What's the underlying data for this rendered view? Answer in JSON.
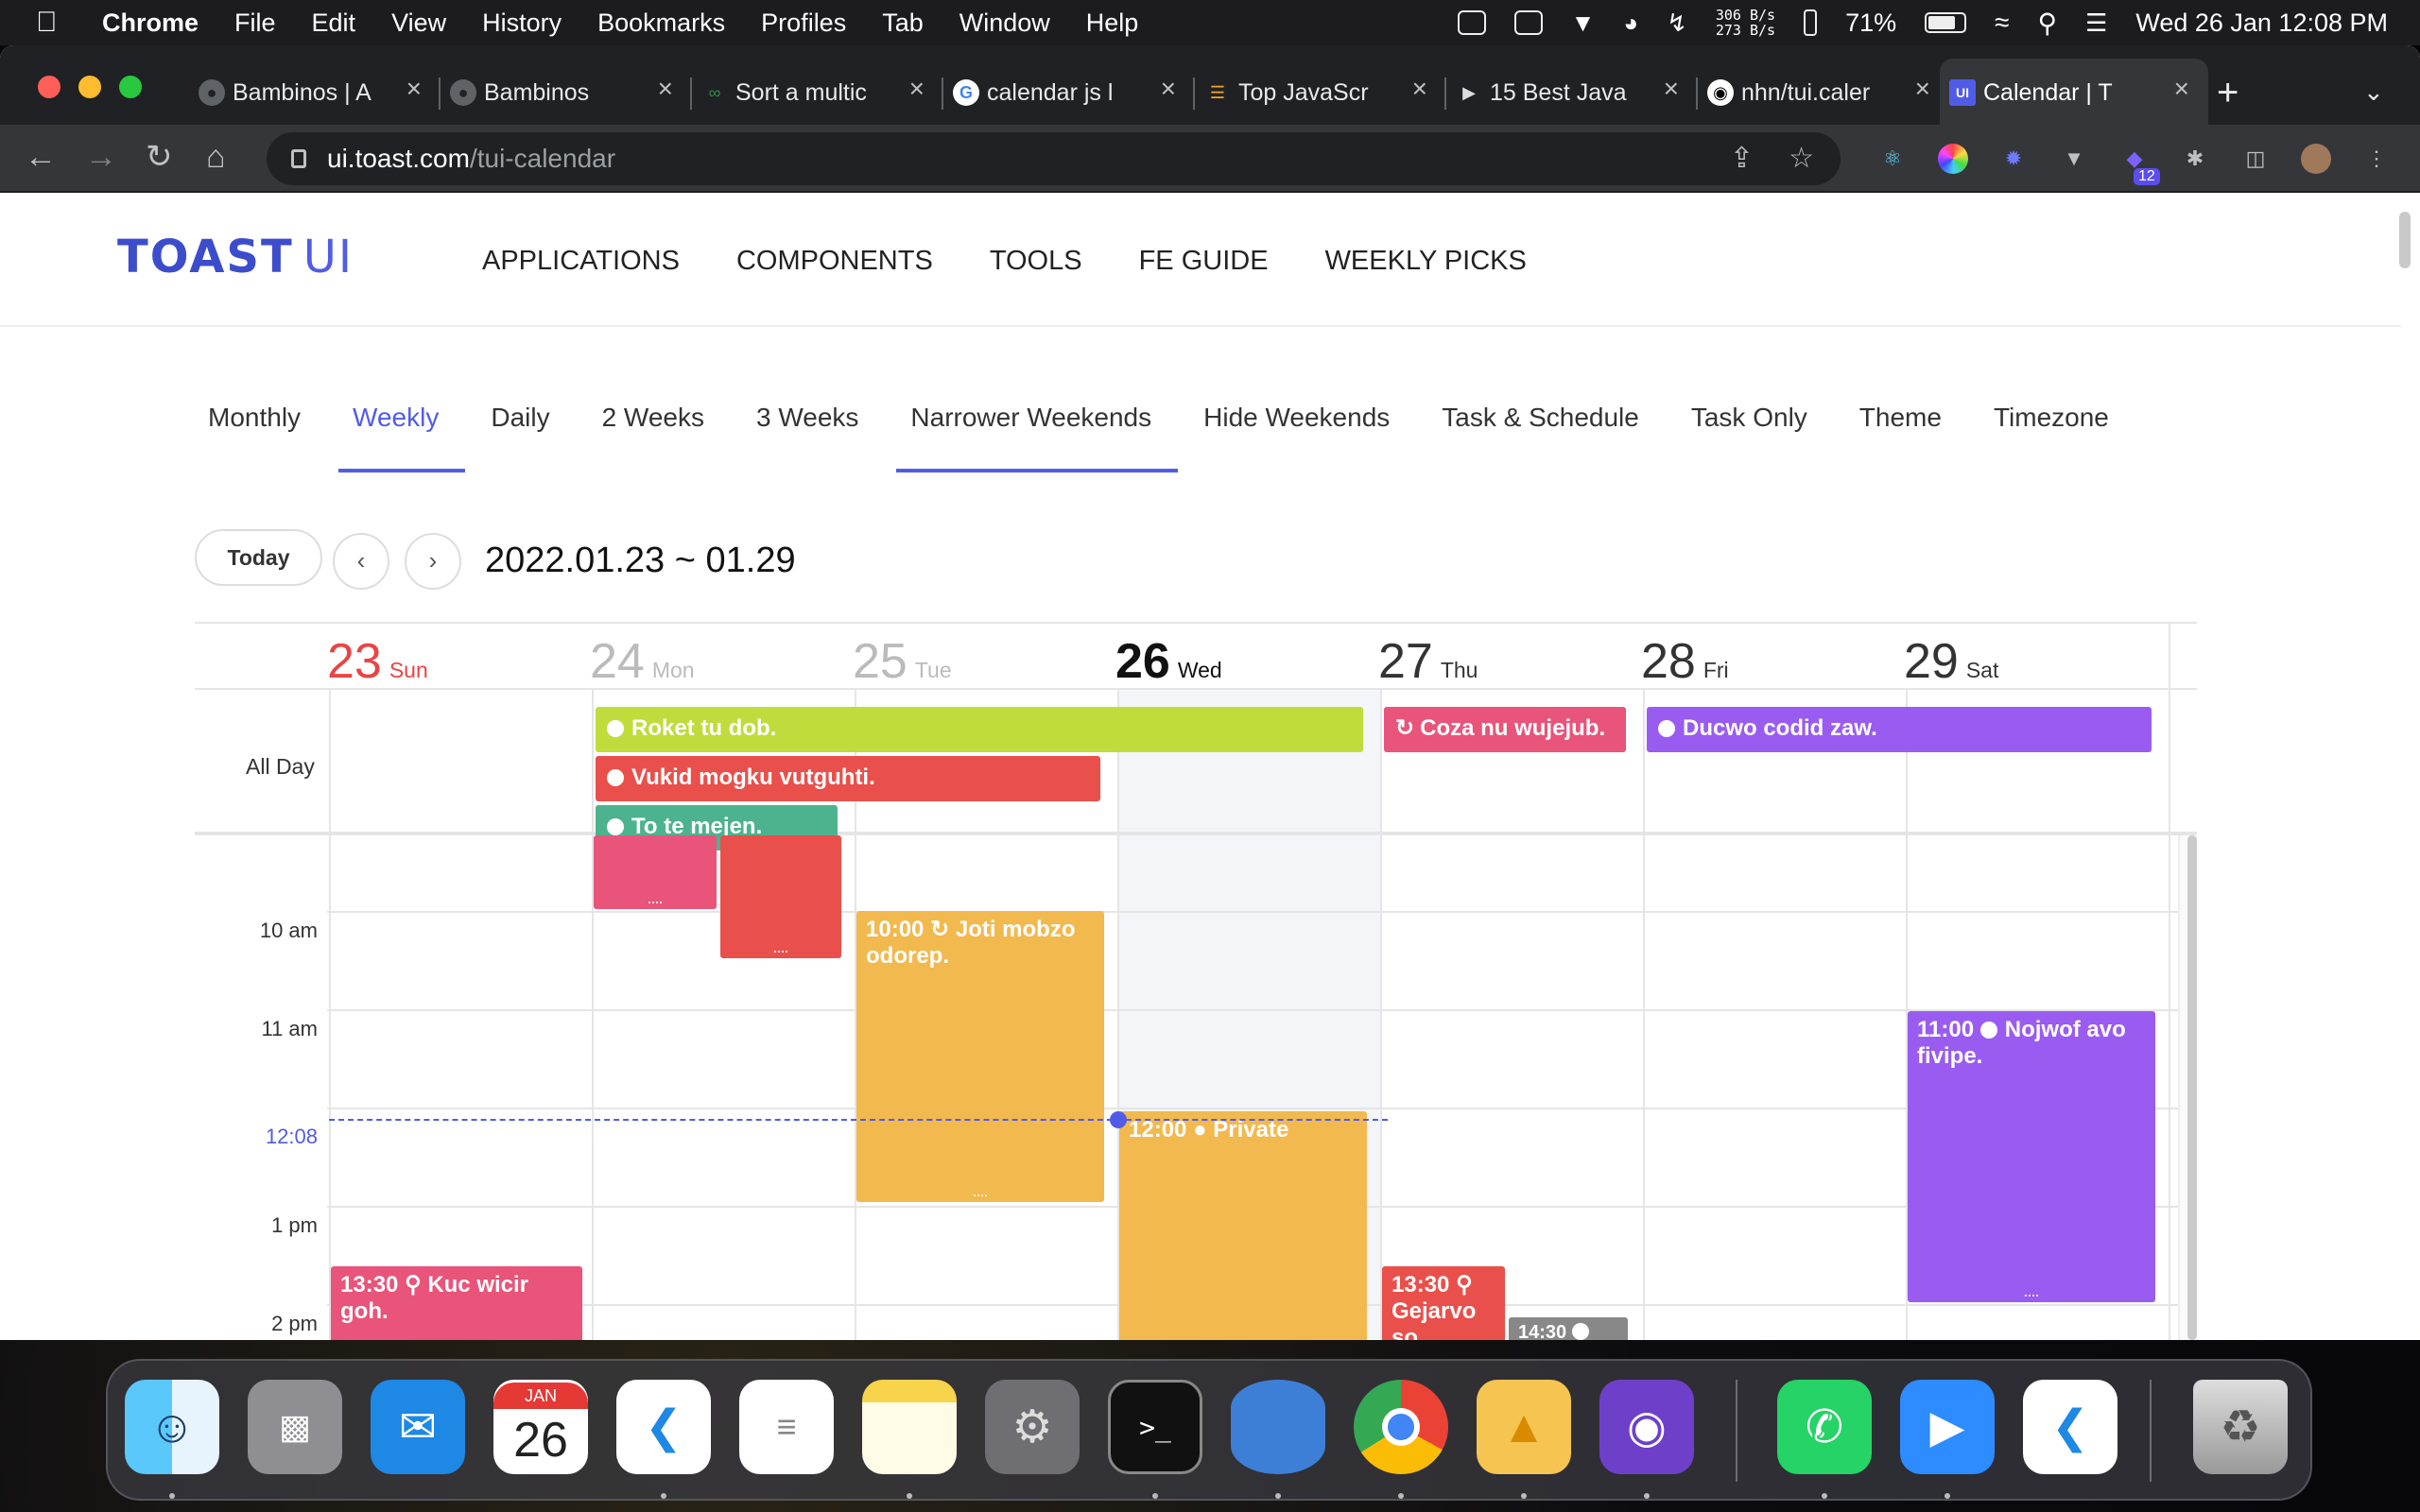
{
  "menubar": {
    "app": "Chrome",
    "items": [
      "File",
      "Edit",
      "View",
      "History",
      "Bookmarks",
      "Profiles",
      "Tab",
      "Window",
      "Help"
    ],
    "net_up": "306 B/s",
    "net_down": "273 B/s",
    "battery": "71%",
    "datetime": "Wed 26 Jan  12:08 PM"
  },
  "tabs": [
    {
      "title": "Bambinos | A",
      "icon": "globe-icon"
    },
    {
      "title": "Bambinos",
      "icon": "globe-icon"
    },
    {
      "title": "Sort a multic",
      "icon": "geeks-icon"
    },
    {
      "title": "calendar js l",
      "icon": "google-icon"
    },
    {
      "title": "Top JavaScr",
      "icon": "list-icon"
    },
    {
      "title": "15 Best Java",
      "icon": "play-icon"
    },
    {
      "title": "nhn/tui.caler",
      "icon": "github-icon"
    },
    {
      "title": "Calendar | T",
      "icon": "toastui-icon"
    }
  ],
  "address": {
    "host": "ui.toast.com",
    "path": "/tui-calendar"
  },
  "extension_badge": "12",
  "site": {
    "logo": "TOAST",
    "logo_suffix": "UI",
    "nav": [
      "APPLICATIONS",
      "COMPONENTS",
      "TOOLS",
      "FE GUIDE",
      "WEEKLY PICKS"
    ]
  },
  "views": [
    "Monthly",
    "Weekly",
    "Daily",
    "2 Weeks",
    "3 Weeks",
    "Narrower Weekends",
    "Hide Weekends",
    "Task & Schedule",
    "Task Only",
    "Theme",
    "Timezone"
  ],
  "toolbar": {
    "today": "Today",
    "prev": "‹",
    "next": "›",
    "range": "2022.01.23 ~ 01.29"
  },
  "days": [
    {
      "num": "23",
      "name": "Sun",
      "color": "#e94444"
    },
    {
      "num": "24",
      "name": "Mon",
      "color": "#bbbbbb"
    },
    {
      "num": "25",
      "name": "Tue",
      "color": "#bbbbbb"
    },
    {
      "num": "26",
      "name": "Wed",
      "color": "#111111"
    },
    {
      "num": "27",
      "name": "Thu",
      "color": "#333333"
    },
    {
      "num": "28",
      "name": "Fri",
      "color": "#333333"
    },
    {
      "num": "29",
      "name": "Sat",
      "color": "#333333"
    }
  ],
  "allday_label": "All Day",
  "allday_events": [
    {
      "title": "Roket tu dob.",
      "color": "#c0dc3c",
      "icon": "person-icon"
    },
    {
      "title": "Vukid mogku vutguhti.",
      "color": "#e9504b",
      "icon": "person-icon"
    },
    {
      "title": "To te mejen.",
      "color": "#4db38f",
      "icon": "person-icon"
    },
    {
      "title": "Coza nu wujejub.",
      "color": "#e9547a",
      "icon": "repeat-icon"
    },
    {
      "title": "Ducwo codid zaw.",
      "color": "#9a5cf0",
      "icon": "person-icon"
    }
  ],
  "hours": [
    "10 am",
    "11 am",
    "12:08",
    "1 pm",
    "2 pm"
  ],
  "time_events": [
    {
      "time": "10:00",
      "title": "Joti mobzo odorep.",
      "color": "#f2b94f",
      "icon": "repeat-icon"
    },
    {
      "time": "12:00",
      "title": "Private",
      "color": "#f2b94f",
      "icon": "lock-icon"
    },
    {
      "time": "11:00",
      "title": "Nojwof avo fivipe.",
      "color": "#9a5cf0",
      "icon": "person-icon"
    },
    {
      "time": "13:30",
      "title": "Kuc wicir goh.",
      "color": "#e9547a",
      "icon": "pin-icon"
    },
    {
      "time": "13:30",
      "title": "Gejarvo so goloco.",
      "color": "#e9504b",
      "icon": "pin-icon"
    },
    {
      "time": "14:30",
      "title": "",
      "color": "#888888",
      "icon": "person-icon"
    }
  ],
  "dock": [
    "Finder",
    "Launchpad",
    "Mail",
    "Calendar",
    "VS Code",
    "Reminders",
    "Notes",
    "System Preferences",
    "Terminal",
    "Database",
    "Chrome",
    "TablePlus",
    "GitHub Desktop",
    "WhatsApp",
    "Zoom",
    "VS Code Insiders",
    "Trash"
  ],
  "dock_calendar": {
    "month": "JAN",
    "day": "26"
  }
}
